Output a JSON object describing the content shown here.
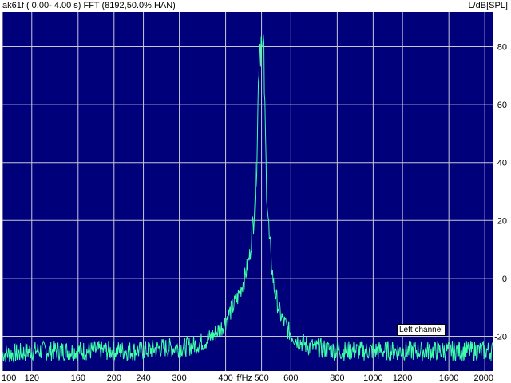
{
  "window": {
    "title_left": "ak61f ( 0.00- 4.00 s) FFT (8192,50.0%,HAN)",
    "title_right": "L/dB[SPL]"
  },
  "colors": {
    "plot_background": "#00007a",
    "grid": "#c8c8d8",
    "trace": "#40ffa8",
    "axis_text": "#000000"
  },
  "chart_data": {
    "type": "line",
    "title": "ak61f ( 0.00- 4.00 s) FFT (8192,50.0%,HAN)",
    "xlabel": "f/Hz",
    "ylabel": "L/dB[SPL]",
    "x_scale": "log",
    "xlim": [
      100,
      2100
    ],
    "ylim": [
      -32,
      92
    ],
    "x_ticks": [
      100,
      120,
      160,
      200,
      240,
      300,
      400,
      500,
      600,
      800,
      1000,
      1200,
      1600,
      2000
    ],
    "x_tick_labels": [
      "100",
      "120",
      "160",
      "200",
      "240",
      "300",
      "400",
      "500",
      "600",
      "800",
      "1000",
      "1200",
      "1600",
      "2000"
    ],
    "y_ticks": [
      -20,
      0,
      20,
      40,
      60,
      80
    ],
    "y_tick_labels": [
      "-20",
      "0",
      "20",
      "40",
      "60",
      "80"
    ],
    "grid": true,
    "legend": "bottom-right",
    "series": [
      {
        "name": "Left channel",
        "x": [
          100,
          110,
          120,
          140,
          160,
          180,
          200,
          220,
          240,
          270,
          300,
          330,
          360,
          390,
          410,
          430,
          450,
          465,
          475,
          485,
          490,
          494,
          497,
          500,
          503,
          506,
          510,
          515,
          525,
          540,
          560,
          590,
          620,
          660,
          700,
          800,
          900,
          1000,
          1100,
          1200,
          1400,
          1600,
          1800,
          2000,
          2100
        ],
        "values": [
          -26,
          -26,
          -25,
          -25,
          -25,
          -25,
          -25,
          -25,
          -25,
          -24,
          -24,
          -23,
          -21,
          -17,
          -12,
          -7,
          0,
          8,
          20,
          40,
          65,
          84,
          78,
          88,
          76,
          83,
          60,
          35,
          12,
          -3,
          -12,
          -18,
          -21,
          -23,
          -24,
          -25,
          -25,
          -25,
          -25,
          -25,
          -25,
          -25,
          -25,
          -25,
          -25
        ]
      }
    ]
  }
}
